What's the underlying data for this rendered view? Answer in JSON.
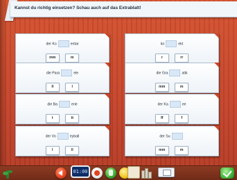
{
  "instruction": "Kannst du richtig einsetzen? Schau auch auf das Extrablatt!",
  "cards": [
    {
      "before": "der Ko",
      "after": "entar",
      "options": [
        "mm",
        "m"
      ]
    },
    {
      "before": "ko",
      "after": "ekt",
      "options": [
        "r",
        "rr"
      ]
    },
    {
      "before": "die Para",
      "after": "ele",
      "options": [
        "ll",
        "l"
      ]
    },
    {
      "before": "die Gra",
      "after": "atik",
      "options": [
        "mm",
        "m"
      ]
    },
    {
      "before": "die Ba",
      "after": "erie",
      "options": [
        "t",
        "tt"
      ]
    },
    {
      "before": "der Ka",
      "after": "ee",
      "options": [
        "ff",
        "f"
      ]
    },
    {
      "before": "der Vo",
      "after": "eyball",
      "options": [
        "l",
        "ll"
      ]
    },
    {
      "before": "der Su",
      "after": "",
      "options": [
        "mm",
        "m"
      ]
    }
  ],
  "toolbar": {
    "timer": "01:00",
    "icons": [
      "plant-icon",
      "back-arrow-icon",
      "timer-display",
      "target-icon",
      "green-cup-icon",
      "yellow-ball-icon",
      "book-icon",
      "bars-icon",
      "card-icon",
      "check-icon"
    ]
  },
  "colors": {
    "background": "#c9482a",
    "card": "#ffffff",
    "gap": "#d8e8f7",
    "timer_bg": "#0e2d66",
    "check": "#43b33a"
  }
}
